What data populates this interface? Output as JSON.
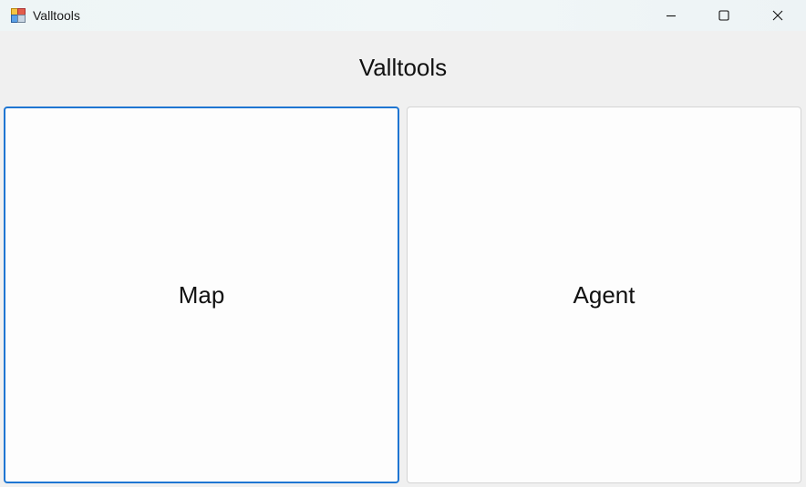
{
  "window": {
    "title": "Valltools",
    "icons": {
      "app": "app-window-icon",
      "minimize": "minimize-icon",
      "maximize": "maximize-icon",
      "close": "close-icon"
    }
  },
  "form": {
    "heading": "Valltools",
    "buttons": {
      "map_label": "Map",
      "agent_label": "Agent"
    }
  },
  "colors": {
    "focus_border": "#1f76d2",
    "form_background": "#f0f0f0",
    "button_background": "#fdfdfd"
  }
}
